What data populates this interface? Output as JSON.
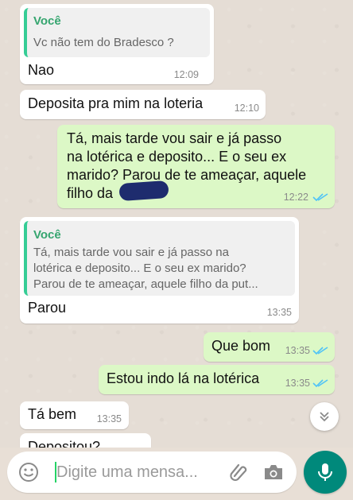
{
  "messages": [
    {
      "quote_author": "Você",
      "quote_text": "Vc não tem do Bradesco ?",
      "text": "Nao",
      "time": "12:09"
    },
    {
      "text": "Deposita pra mim na loteria",
      "time": "12:10"
    },
    {
      "lines": [
        "Tá, mais tarde vou sair e já passo",
        "na lotérica e deposito... E o seu ex",
        "marido? Parou de te ameaçar, aquele",
        "filho da"
      ],
      "time": "12:22"
    },
    {
      "quote_author": "Você",
      "quote_lines": [
        "Tá, mais tarde vou sair e já passo na",
        "lotérica e deposito... E o seu ex marido?",
        "Parou de te ameaçar, aquele filho da put..."
      ],
      "text": "Parou",
      "time": "13:35"
    },
    {
      "text": "Que bom",
      "time": "13:35"
    },
    {
      "text": "Estou indo lá na lotérica",
      "time": "13:35"
    },
    {
      "text": "Tá bem",
      "time": "13:35"
    },
    {
      "text": "Depositou?"
    }
  ],
  "input": {
    "placeholder": "Digite uma mensa..."
  },
  "colors": {
    "outgoing": "#dcf8c6",
    "incoming": "#ffffff",
    "read_ticks": "#4fc3f7",
    "accent": "#00897b"
  }
}
